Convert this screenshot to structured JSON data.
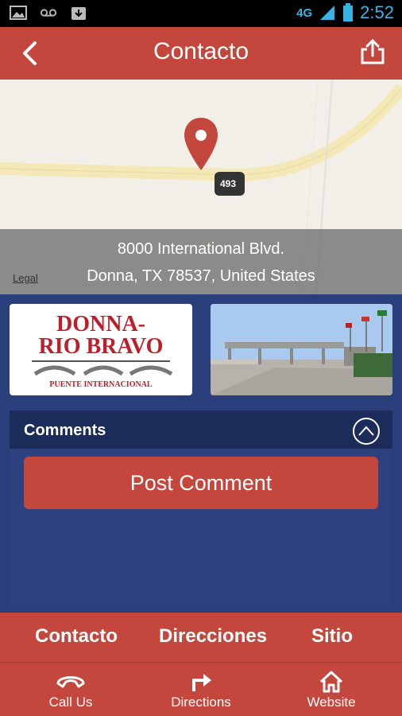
{
  "status_bar": {
    "icons": [
      "image-icon",
      "voicemail-icon",
      "download-icon",
      "network-4g-icon",
      "signal-icon",
      "battery-icon"
    ],
    "network_label": "4G",
    "time": "2:52"
  },
  "app_bar": {
    "title": "Contacto",
    "back_icon": "chevron-left-icon",
    "share_icon": "share-icon"
  },
  "map": {
    "address_line1": "8000 International Blvd.",
    "address_line2": "Donna, TX 78537, United States",
    "legal_link": "Legal",
    "route_badge": "493"
  },
  "photos": {
    "logo": {
      "line1": "DONNA-",
      "line2": "RIO BRAVO",
      "line3": "PUENTE INTERNACIONAL"
    }
  },
  "comments": {
    "header": "Comments",
    "toggle_icon": "chevron-up-circle-icon",
    "post_button": "Post Comment"
  },
  "tabs": [
    "Contacto",
    "Direcciones",
    "Sitio"
  ],
  "bottom_nav": [
    {
      "label": "Call Us",
      "icon": "phone-icon"
    },
    {
      "label": "Directions",
      "icon": "turn-right-arrow-icon"
    },
    {
      "label": "Website",
      "icon": "home-icon"
    }
  ],
  "colors": {
    "accent_red": "#c4473d",
    "navy": "#2a3e7c",
    "dark_navy": "#1c2c5a",
    "clock_blue": "#35b5e5"
  }
}
